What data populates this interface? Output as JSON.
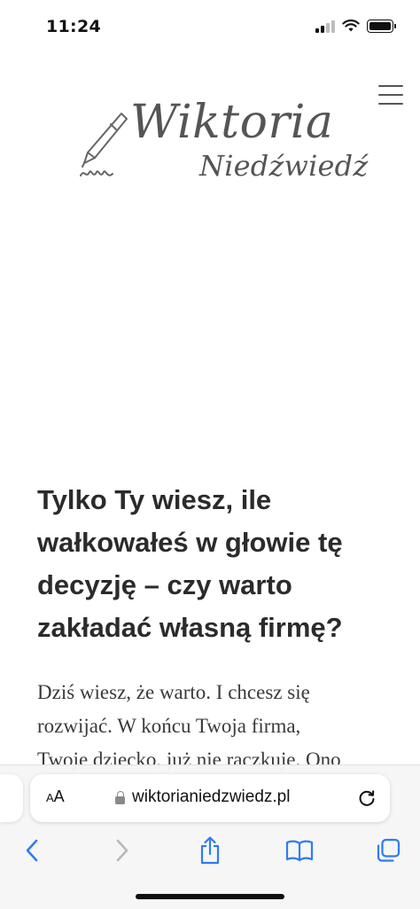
{
  "status_bar": {
    "time": "11:24",
    "battery_level": 1.0
  },
  "header": {
    "logo_line1": "Wiktoria",
    "logo_line2": "Niedźwiedź",
    "logo_icon": "fountain-pen-icon",
    "menu_icon": "hamburger-menu-icon"
  },
  "article": {
    "headline": "Tylko Ty wiesz, ile wałkowałeś w głowie tę decyzję – czy warto zakładać własną firmę?",
    "body_lines": [
      "Dziś wiesz, że warto. I chcesz się",
      "rozwijać. W końcu Twoja firma,",
      "Twoje dziecko, już nie raczkuje. Ono"
    ]
  },
  "browser": {
    "text_size_small": "A",
    "text_size_big": "A",
    "url": "wiktorianiedzwiedz.pl",
    "icons": {
      "lock": "lock-icon",
      "reload": "reload-icon",
      "back": "chevron-left-icon",
      "forward": "chevron-right-icon",
      "share": "share-icon",
      "bookmarks": "book-icon",
      "tabs": "tabs-icon"
    },
    "accent_color": "#2f7bf5",
    "disabled_color": "#b9b9b9"
  }
}
